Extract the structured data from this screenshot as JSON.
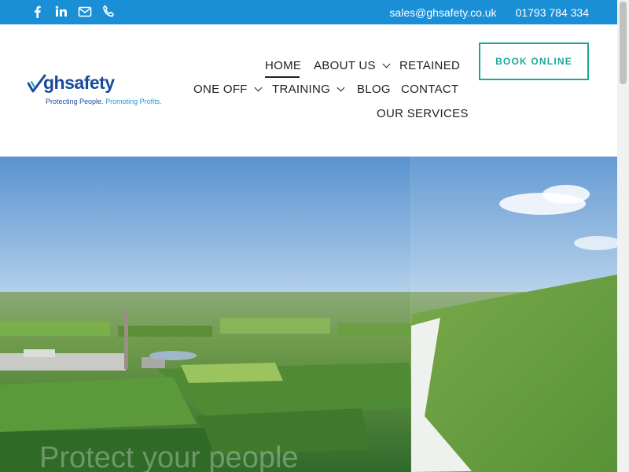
{
  "topbar": {
    "icons": [
      "facebook-icon",
      "linkedin-icon",
      "email-icon",
      "phone-icon"
    ],
    "email": "sales@ghsafety.co.uk",
    "phone": "01793 784 334",
    "bg_color": "#1a8fd6"
  },
  "logo": {
    "brand_a": "gh",
    "brand_b": "safety",
    "tagline_a": "Protecting People.",
    "tagline_b": "Promoting Profits."
  },
  "nav": {
    "items": [
      {
        "label": "HOME"
      },
      {
        "label": "ABOUT US"
      },
      {
        "label": "RETAINED"
      },
      {
        "label": "ONE OFF"
      },
      {
        "label": "TRAINING"
      },
      {
        "label": "BLOG"
      },
      {
        "label": "CONTACT"
      },
      {
        "label": "OUR SERVICES"
      }
    ],
    "book_label": "BOOK ONLINE",
    "accent_color": "#1aa89a"
  },
  "hero": {
    "overlay_text": "Protect your people"
  }
}
